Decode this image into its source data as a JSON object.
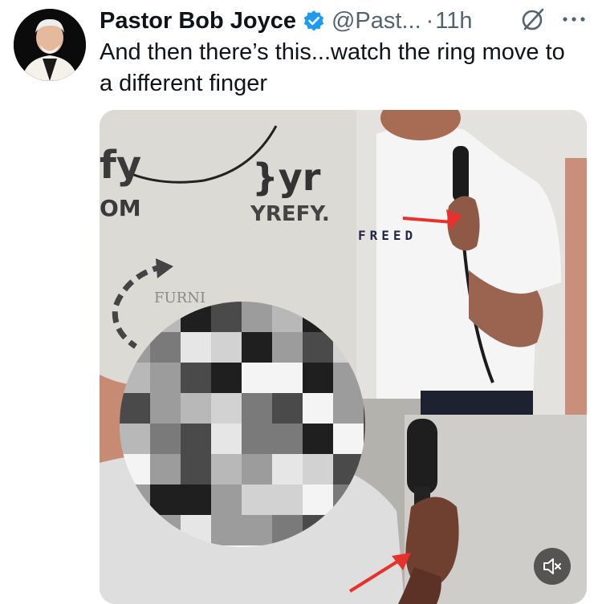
{
  "tweet": {
    "author_name": "Pastor Bob Joyce",
    "handle": "@Past...",
    "separator": "·",
    "time": "11h",
    "text": "And then there’s this...watch the ring move to a different finger",
    "verified": true
  },
  "icons": {
    "verified": "verified-badge-icon",
    "grok": "grok-icon",
    "more": "more-icon",
    "mute": "volume-mute-icon"
  },
  "media": {
    "type": "video",
    "muted": true
  },
  "colors": {
    "text_primary": "#0f1419",
    "text_secondary": "#536471",
    "verified": "#1d9bf0",
    "arrow": "#e8312a"
  }
}
